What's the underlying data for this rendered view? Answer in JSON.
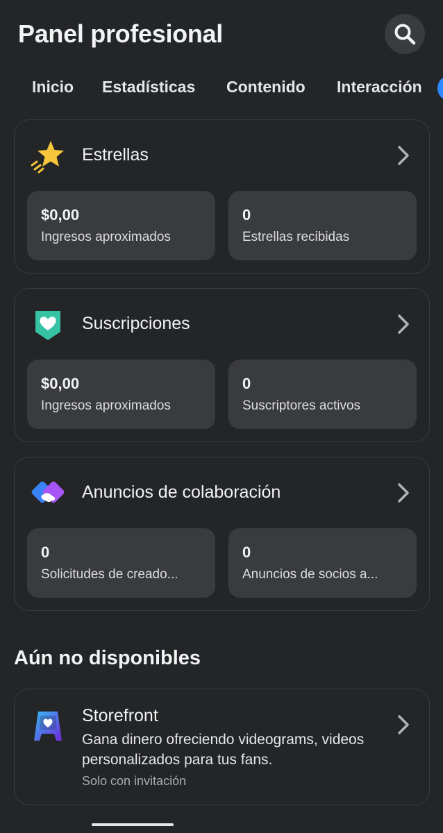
{
  "header": {
    "title": "Panel profesional",
    "search_icon": "search-icon"
  },
  "tabs": [
    {
      "label": "Inicio"
    },
    {
      "label": "Estadísticas"
    },
    {
      "label": "Contenido"
    },
    {
      "label": "Interacción"
    }
  ],
  "cards": [
    {
      "title": "Estrellas",
      "icon": "star-icon",
      "stats": [
        {
          "value": "$0,00",
          "label": "Ingresos aproximados"
        },
        {
          "value": "0",
          "label": "Estrellas recibidas"
        }
      ]
    },
    {
      "title": "Suscripciones",
      "icon": "heart-shield-icon",
      "stats": [
        {
          "value": "$0,00",
          "label": "Ingresos aproximados"
        },
        {
          "value": "0",
          "label": "Suscriptores activos"
        }
      ]
    },
    {
      "title": "Anuncios de colaboración",
      "icon": "handshake-icon",
      "stats": [
        {
          "value": "0",
          "label": "Solicitudes de creado..."
        },
        {
          "value": "0",
          "label": "Anuncios de socios a..."
        }
      ]
    }
  ],
  "unavailable": {
    "section_title": "Aún no disponibles",
    "storefront": {
      "title": "Storefront",
      "description": "Gana dinero ofreciendo videograms, videos personalizados para tus fans.",
      "note": "Solo con invitación",
      "icon": "storefront-icon"
    }
  },
  "colors": {
    "background": "#242526",
    "surface": "#3a3b3c",
    "accent": "#2d88ff"
  }
}
